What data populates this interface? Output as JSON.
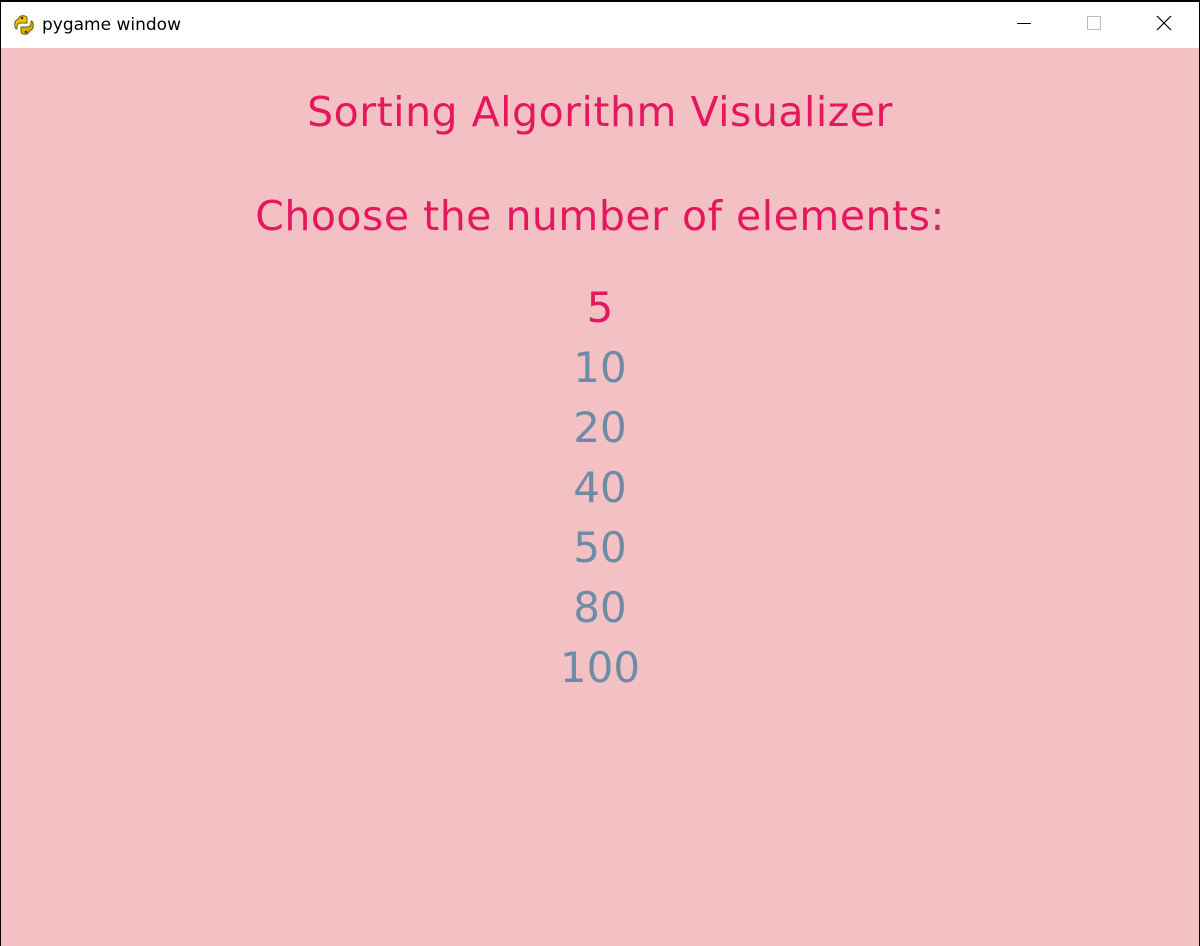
{
  "window": {
    "title": "pygame window"
  },
  "titlebar_icons": {
    "app": "pygame-snake-icon",
    "minimize": "minimize-icon",
    "maximize": "maximize-icon",
    "close": "close-icon"
  },
  "main": {
    "app_title": "Sorting Algorithm Visualizer",
    "prompt": "Choose the number of elements:",
    "options": [
      "5",
      "10",
      "20",
      "40",
      "50",
      "80",
      "100"
    ],
    "selected_option": "5"
  },
  "colors": {
    "background": "#f3c1c3",
    "accent": "#e5175e",
    "option_default": "#6f8ca6"
  }
}
